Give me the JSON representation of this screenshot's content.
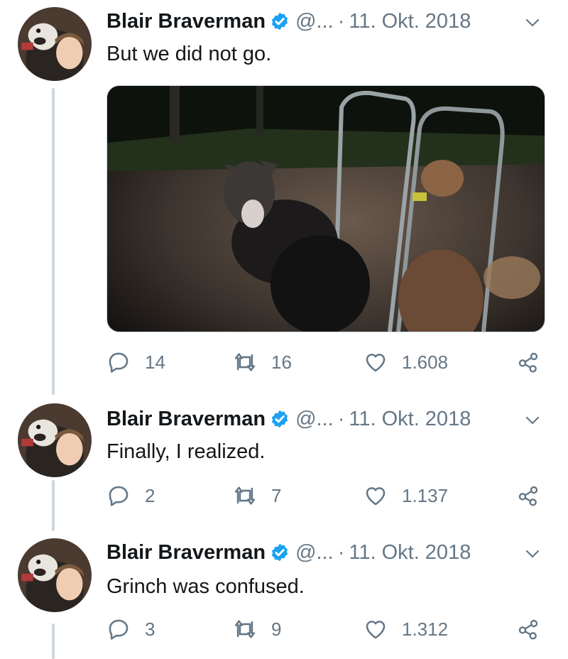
{
  "tweets": [
    {
      "name": "Blair Braverman",
      "handle": "@...",
      "separator": "·",
      "date": "11. Okt. 2018",
      "text": "But we did not go.",
      "has_media": true,
      "replies": "14",
      "retweets": "16",
      "likes": "1.608"
    },
    {
      "name": "Blair Braverman",
      "handle": "@...",
      "separator": "·",
      "date": "11. Okt. 2018",
      "text": "Finally, I realized.",
      "has_media": false,
      "replies": "2",
      "retweets": "7",
      "likes": "1.137"
    },
    {
      "name": "Blair Braverman",
      "handle": "@...",
      "separator": "·",
      "date": "11. Okt. 2018",
      "text": "Grinch was confused.",
      "has_media": false,
      "replies": "3",
      "retweets": "9",
      "likes": "1.312"
    }
  ],
  "colors": {
    "verified": "#1da1f2",
    "muted": "#657786",
    "text": "#14171a",
    "thread_line": "#ccd6dd"
  },
  "icons": [
    "verified-badge-icon",
    "chevron-down-icon",
    "reply-icon",
    "retweet-icon",
    "like-icon",
    "share-icon"
  ]
}
